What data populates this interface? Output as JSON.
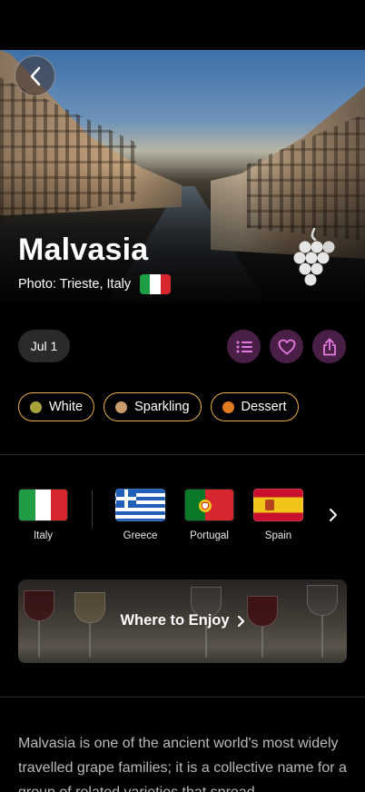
{
  "hero": {
    "title": "Malvasia",
    "photo_caption": "Photo: Trieste, Italy"
  },
  "actions": {
    "date": "Jul 1",
    "list_icon": "list-icon",
    "favorite_icon": "heart-icon",
    "share_icon": "share-icon"
  },
  "tags": [
    {
      "label": "White",
      "color": "#a8a03a"
    },
    {
      "label": "Sparkling",
      "color": "#c99a6b"
    },
    {
      "label": "Dessert",
      "color": "#e07b1f"
    }
  ],
  "regions": [
    {
      "label": "Italy"
    },
    {
      "label": "Greece"
    },
    {
      "label": "Portugal"
    },
    {
      "label": "Spain"
    }
  ],
  "where_to_enjoy": {
    "label": "Where to Enjoy"
  },
  "description": "Malvasia is one of the ancient world's most widely travelled grape families; it is a collective name for a group of related varieties that spread"
}
